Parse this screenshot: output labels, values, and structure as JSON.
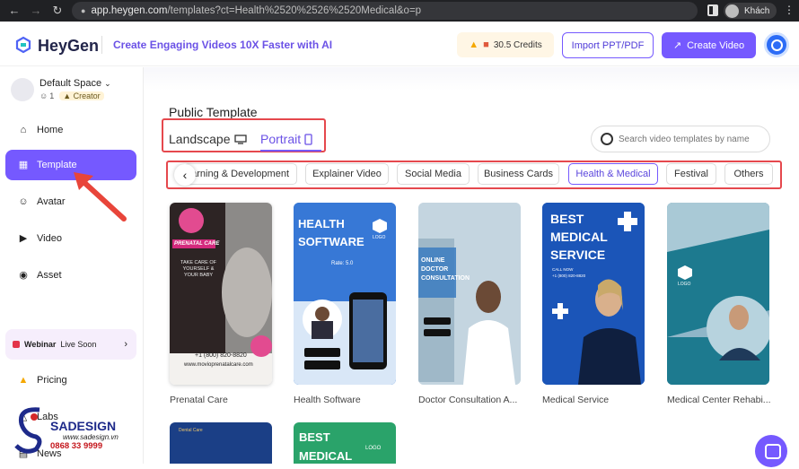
{
  "browser": {
    "url_host": "app.heygen.com",
    "url_path": "/templates?ct=Health%2520%2526%2520Medical&o=p",
    "profile_name": "Khách"
  },
  "header": {
    "logo_text": "HeyGen",
    "tagline": "Create Engaging Videos 10X Faster with AI",
    "credits": "30.5 Credits",
    "import_label": "Import PPT/PDF",
    "create_label": "Create Video"
  },
  "sidebar": {
    "space_name": "Default Space",
    "member_count": "1",
    "role": "Creator",
    "items": [
      {
        "label": "Home",
        "icon": "home-icon"
      },
      {
        "label": "Template",
        "icon": "template-icon"
      },
      {
        "label": "Avatar",
        "icon": "avatar-icon"
      },
      {
        "label": "Video",
        "icon": "video-icon"
      },
      {
        "label": "Asset",
        "icon": "asset-icon"
      }
    ],
    "webinar_strong": "Webinar",
    "webinar_rest": "Live Soon",
    "pricing": "Pricing",
    "labs": "Labs",
    "news": "News"
  },
  "main": {
    "section_title": "Public Template",
    "orientation_tabs": [
      "Landscape",
      "Portrait"
    ],
    "selected_orientation": "Portrait",
    "search_placeholder": "Search video templates by name",
    "categories": [
      "Learning & Development",
      "Explainer Video",
      "Social Media",
      "Business Cards",
      "Health & Medical",
      "Festival",
      "Others"
    ],
    "first_category_visible": "arning & Development",
    "selected_category": "Health & Medical",
    "templates": [
      {
        "name": "Prenatal Care"
      },
      {
        "name": "Health Software"
      },
      {
        "name": "Doctor Consultation A..."
      },
      {
        "name": "Medical Service"
      },
      {
        "name": "Medical Center Rehabi..."
      }
    ],
    "thumbs": {
      "prenatal_heading": "PRENATAL CARE",
      "prenatal_sub": "TAKE CARE OF YOURSELF & YOUR BABY",
      "prenatal_phone": "+1 (800) 820-8820",
      "prenatal_site": "www.movioprenatalcare.com",
      "health_title_1": "HEALTH",
      "health_title_2": "SOFTWARE",
      "health_logo": "LOGO",
      "health_rate": "Rate: 5.0",
      "doctor_title": "ONLINE DOCTOR CONSULTATION",
      "medical_title_1": "BEST",
      "medical_title_2": "MEDICAL",
      "medical_title_3": "SERVICE",
      "medical_call": "CALL NOW",
      "medical_phone": "+1 (800) 820-8820",
      "rehab_logo": "LOGO",
      "row2_dental": "Dental Care",
      "row2_best": "BEST",
      "row2_medical": "MEDICAL",
      "row2_logo": "LOGO"
    }
  },
  "watermark": {
    "brand": "SADESIGN",
    "site": "www.sadesign.vn",
    "phone": "0868 33 9999"
  },
  "colors": {
    "accent": "#7559ff",
    "highlight_box": "#e5484d",
    "arrow": "#e8453a"
  }
}
